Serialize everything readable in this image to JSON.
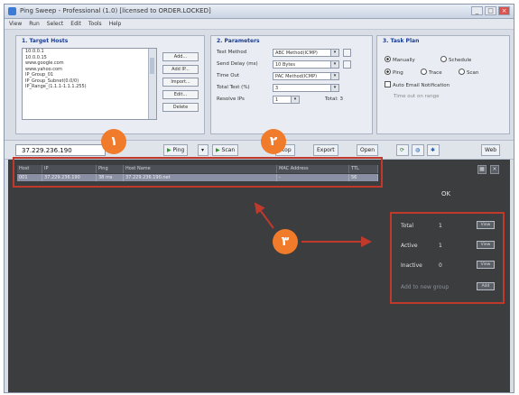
{
  "window": {
    "title": "Ping Sweep - Professional (1.0) [licensed to ORDER.LOCKED]"
  },
  "menu": [
    "View",
    "Run",
    "Select",
    "Edit",
    "Tools",
    "Help"
  ],
  "targets": {
    "title": "1. Target Hosts",
    "items": [
      "10.0.0.1",
      "10.0.0.15",
      "www.google.com",
      "www.yahoo.com",
      "IP_Group_01",
      "IP_Group_Subnet(0.0/0)",
      "IP_Range_(1.1.1-1.1.1.255)"
    ],
    "buttons": [
      "Add...",
      "Add IP...",
      "Import...",
      "Edit...",
      "Delete"
    ]
  },
  "params": {
    "title": "2. Parameters",
    "rows": [
      {
        "label": "Test Method",
        "value": "ABC Method(ICMP)"
      },
      {
        "label": "Send Delay (ms)",
        "value": "10 Bytes"
      },
      {
        "label": "Time Out",
        "value": "PAC Method(ICMP)"
      },
      {
        "label": "Total Test (%)",
        "value": "3"
      },
      {
        "label": "Resolve IPs",
        "value": "1",
        "extra": "Total: 3"
      }
    ]
  },
  "task": {
    "title": "3. Task Plan",
    "options": [
      "Manually",
      "Schedule",
      "Ping",
      "Trace",
      "Scan",
      "Auto Email Notification",
      "Time out on range"
    ]
  },
  "toolbar": {
    "ip": "37.229.236.190",
    "buttons": [
      "Ping",
      "Scan",
      "Stop",
      "Export",
      "Open",
      "Web"
    ]
  },
  "grid": {
    "headers": [
      "Host",
      "IP",
      "Ping",
      "Host Name",
      "MAC Address",
      "TTL"
    ],
    "row": [
      "001",
      "37.229.236.190",
      "38 ms",
      "37.229.236.190.net",
      "-",
      "56"
    ]
  },
  "results_status": "OK",
  "stats": [
    {
      "label": "Total",
      "value": "1",
      "btn": "View"
    },
    {
      "label": "Active",
      "value": "1",
      "btn": "View"
    },
    {
      "label": "Inactive",
      "value": "0",
      "btn": "View"
    },
    {
      "label": "Add to new group",
      "value": "",
      "btn": "Add"
    }
  ],
  "annotations": {
    "b1": "۱",
    "b2": "۲",
    "b3": "۳"
  }
}
